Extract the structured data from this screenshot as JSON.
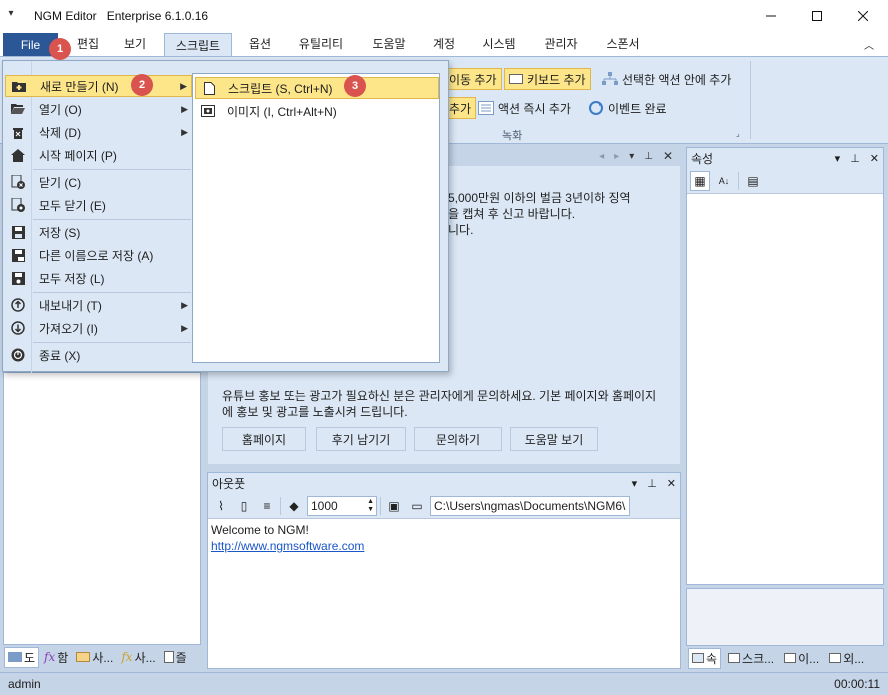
{
  "app": {
    "name": "NGM Editor",
    "version": "Enterprise 6.1.0.16"
  },
  "menubar": {
    "file": "File",
    "tabs": [
      "편집",
      "보기",
      "스크립트",
      "옵션",
      "유틸리티",
      "도움말",
      "계정",
      "시스템",
      "관리자",
      "스폰서"
    ]
  },
  "ribbon": {
    "btn_move_add": "이동 추가",
    "btn_keyboard_add": "키보드 추가",
    "btn_in_selected": "선택한 액션 안에 추가",
    "btn_add_partial": "추가",
    "btn_immediate_add": "액션 즉시 추가",
    "btn_event_done": "이벤트 완료",
    "group_record": "녹화"
  },
  "file_menu": {
    "items": [
      {
        "label": "새로 만들기 (N)",
        "icon": "new-folder-icon",
        "submenu": true
      },
      {
        "label": "열기 (O)",
        "icon": "open-folder-icon",
        "submenu": true
      },
      {
        "label": "삭제 (D)",
        "icon": "delete-icon",
        "submenu": true
      },
      {
        "label": "시작 페이지 (P)",
        "icon": "home-icon",
        "submenu": false
      },
      {
        "label": "닫기 (C)",
        "icon": "close-doc-icon",
        "submenu": false
      },
      {
        "label": "모두 닫기 (E)",
        "icon": "close-all-icon",
        "submenu": false
      },
      {
        "label": "저장 (S)",
        "icon": "save-icon",
        "submenu": false
      },
      {
        "label": "다른 이름으로 저장 (A)",
        "icon": "save-as-icon",
        "submenu": false
      },
      {
        "label": "모두 저장 (L)",
        "icon": "save-all-icon",
        "submenu": false
      },
      {
        "label": "내보내기 (T)",
        "icon": "export-icon",
        "submenu": true
      },
      {
        "label": "가져오기 (I)",
        "icon": "import-icon",
        "submenu": true
      },
      {
        "label": "종료 (X)",
        "icon": "power-icon",
        "submenu": false
      }
    ]
  },
  "submenu": {
    "items": [
      {
        "label": "스크립트 (S, Ctrl+N)",
        "icon": "document-icon"
      },
      {
        "label": "이미지 (I, Ctrl+Alt+N)",
        "icon": "image-icon"
      }
    ]
  },
  "badges": [
    "1",
    "2",
    "3"
  ],
  "start_page": {
    "warning_lines": [
      "5,000만원 이하의 벌금 3년이하 징역",
      "을 캡쳐 후 신고 바랍니다.",
      "니다."
    ],
    "promo_text": "유튜브 홍보 또는 광고가 필요하신 분은 관리자에게 문의하세요. 기본 페이지와 홈페이지에 홍보 및 광고를 노출시켜 드립니다.",
    "buttons": [
      "홈페이지",
      "후기 남기기",
      "문의하기",
      "도움말 보기"
    ]
  },
  "properties_panel": {
    "title": "속성",
    "tabs": [
      "속",
      "스크...",
      "이...",
      "외..."
    ]
  },
  "output_panel": {
    "title": "아웃풋",
    "number_value": "1000",
    "path": "C:\\Users\\ngmas\\Documents\\NGM6\\",
    "lines": [
      "Welcome to NGM!",
      "http://www.ngmsoftware.com"
    ]
  },
  "left_tabs": [
    "도",
    "함",
    "사...",
    "사...",
    "즐"
  ],
  "status": {
    "user": "admin",
    "time": "00:00:11"
  },
  "colors": {
    "accent": "#2b5797",
    "highlight": "#fde68a",
    "badge": "#d9534f",
    "panel_bg": "#dbe7f5"
  }
}
